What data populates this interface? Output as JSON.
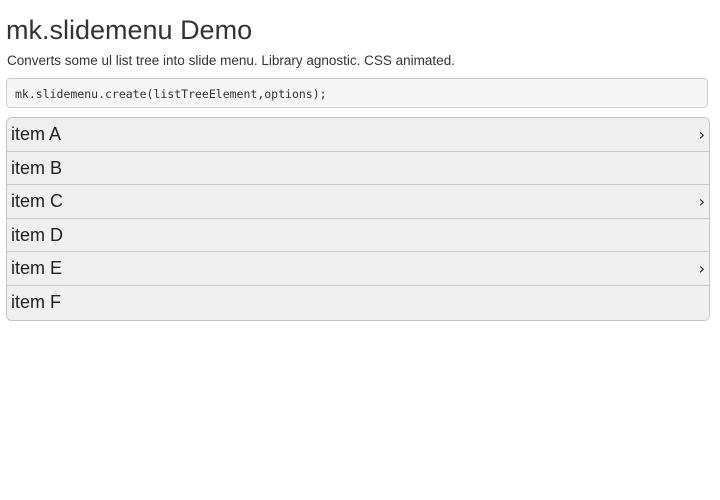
{
  "page": {
    "title": "mk.slidemenu Demo",
    "description": "Converts some ul list tree into slide menu. Library agnostic. CSS animated.",
    "code": "mk.slidemenu.create(listTreeElement,options);"
  },
  "menu": {
    "items": [
      {
        "label": "item A",
        "has_submenu": true,
        "chevron": "›",
        "chevron_icon": "chevron-right-icon"
      },
      {
        "label": "item B",
        "has_submenu": false
      },
      {
        "label": "item C",
        "has_submenu": true,
        "chevron": "›",
        "chevron_icon": "chevron-right-icon"
      },
      {
        "label": "item D",
        "has_submenu": false
      },
      {
        "label": "item E",
        "has_submenu": true,
        "chevron": "›",
        "chevron_icon": "chevron-right-icon"
      },
      {
        "label": "item F",
        "has_submenu": false
      }
    ]
  },
  "colors": {
    "menu_background": "#efefef",
    "menu_border": "#c4c4c4",
    "code_background": "#f5f5f5",
    "text": "#333333"
  }
}
